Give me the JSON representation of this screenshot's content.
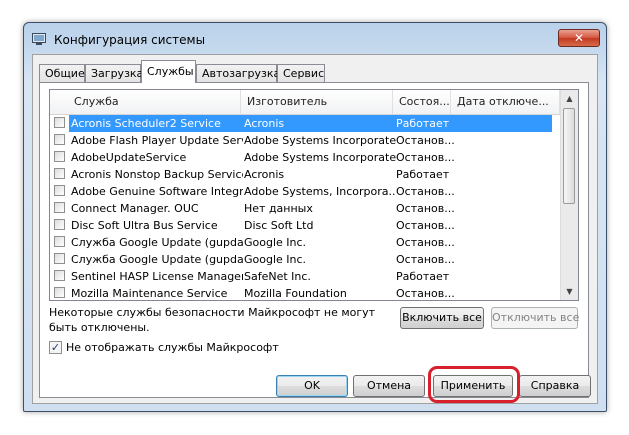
{
  "window": {
    "title": "Конфигурация системы",
    "close_label": "✕"
  },
  "tabs": [
    {
      "label": "Общие",
      "active": false
    },
    {
      "label": "Загрузка",
      "active": false
    },
    {
      "label": "Службы",
      "active": true
    },
    {
      "label": "Автозагрузка",
      "active": false
    },
    {
      "label": "Сервис",
      "active": false
    }
  ],
  "services_table": {
    "columns": [
      "Служба",
      "Изготовитель",
      "Состоя...",
      "Дата отключе..."
    ],
    "rows": [
      {
        "name": "Acronis Scheduler2 Service",
        "vendor": "Acronis",
        "status": "Работает",
        "date": "",
        "checked": false,
        "selected": true
      },
      {
        "name": "Adobe Flash Player Update Service",
        "vendor": "Adobe Systems Incorporated",
        "status": "Останов...",
        "date": "",
        "checked": false,
        "selected": false
      },
      {
        "name": "AdobeUpdateService",
        "vendor": "Adobe Systems Incorporated",
        "status": "Останов...",
        "date": "",
        "checked": false,
        "selected": false
      },
      {
        "name": "Acronis Nonstop Backup Service",
        "vendor": "Acronis",
        "status": "Работает",
        "date": "",
        "checked": false,
        "selected": false
      },
      {
        "name": "Adobe Genuine Software Integri...",
        "vendor": "Adobe Systems, Incorpora...",
        "status": "Останов...",
        "date": "",
        "checked": false,
        "selected": false
      },
      {
        "name": "Connect Manager. OUC",
        "vendor": "Нет данных",
        "status": "Останов...",
        "date": "",
        "checked": false,
        "selected": false
      },
      {
        "name": "Disc Soft Ultra Bus Service",
        "vendor": "Disc Soft Ltd",
        "status": "Останов...",
        "date": "",
        "checked": false,
        "selected": false
      },
      {
        "name": "Служба Google Update (gupdate)",
        "vendor": "Google Inc.",
        "status": "Останов...",
        "date": "",
        "checked": false,
        "selected": false
      },
      {
        "name": "Служба Google Update (gupdatem)",
        "vendor": "Google Inc.",
        "status": "Останов...",
        "date": "",
        "checked": false,
        "selected": false
      },
      {
        "name": "Sentinel HASP License Manager",
        "vendor": "SafeNet Inc.",
        "status": "Работает",
        "date": "",
        "checked": false,
        "selected": false
      },
      {
        "name": "Mozilla Maintenance Service",
        "vendor": "Mozilla Foundation",
        "status": "Останов...",
        "date": "",
        "checked": false,
        "selected": false
      }
    ]
  },
  "note": "Некоторые службы безопасности Майкрософт не могут быть отключены.",
  "buttons": {
    "enable_all": "Включить все",
    "disable_all": "Отключить все",
    "ok": "OK",
    "cancel": "Отмена",
    "apply": "Применить",
    "help": "Справка"
  },
  "hide_ms_services": {
    "label": "Не отображать службы Майкрософт",
    "checked": true
  },
  "colors": {
    "selection": "#3399ff",
    "highlight_frame": "#d8202c",
    "title_gradient": "#b9d1ea"
  }
}
